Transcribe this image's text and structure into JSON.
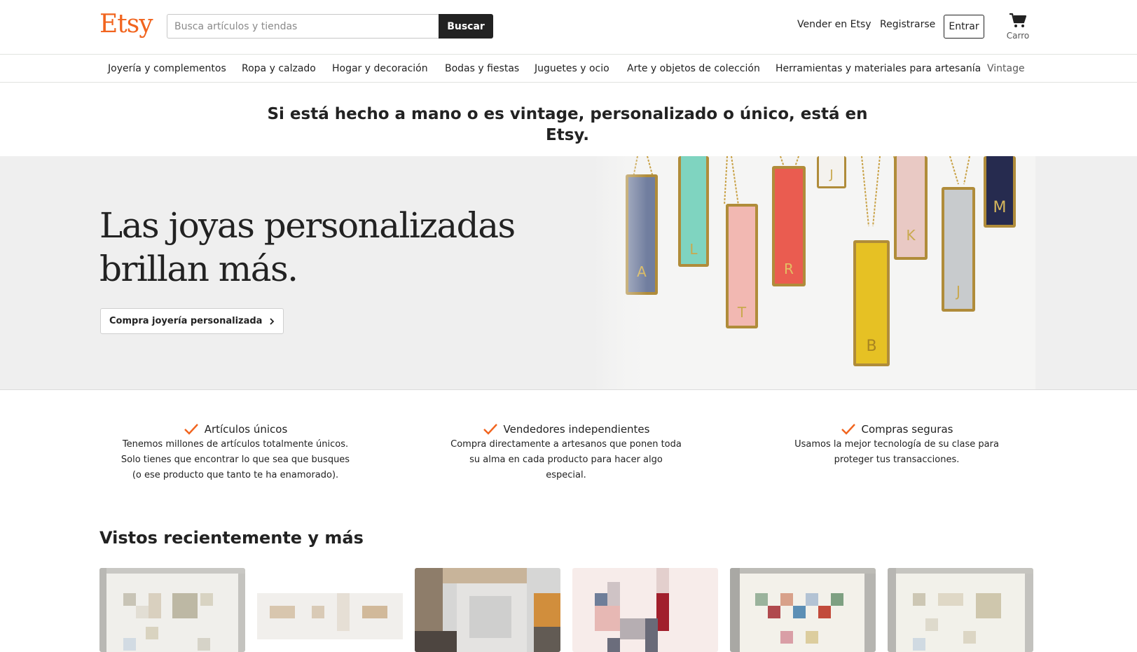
{
  "header": {
    "logo": "Etsy",
    "search_placeholder": "Busca artículos y tiendas",
    "search_button": "Buscar",
    "sell_link": "Vender en Etsy",
    "register_link": "Registrarse",
    "signin_button": "Entrar",
    "cart_label": "Carro",
    "cart_icon": "shopping-cart-icon"
  },
  "categories": [
    "Joyería y complementos",
    "Ropa y calzado",
    "Hogar y decoración",
    "Bodas y fiestas",
    "Juguetes y ocio",
    "Arte y objetos de colección",
    "Herramientas y materiales para artesanía",
    "Vintage"
  ],
  "tagline": {
    "line1": "Si está hecho a mano o es vintage, personalizado o único, está en",
    "line2": "Etsy."
  },
  "hero": {
    "title_line1": "Las joyas personalizadas",
    "title_line2": "brillan más.",
    "cta": "Compra joyería personalizada",
    "pendant_letters": [
      "A",
      "L",
      "T",
      "R",
      "J",
      "B",
      "K",
      "J",
      "M"
    ]
  },
  "value_props": [
    {
      "title": "Artículos únicos",
      "line1": "Tenemos millones de artículos totalmente únicos.",
      "line2": "Solo tienes que encontrar lo que sea que busques",
      "line3": "(o ese producto que tanto te ha enamorado)."
    },
    {
      "title": "Vendedores independientes",
      "line1": "Compra directamente a artesanos que ponen toda",
      "line2": "su alma en cada producto para hacer algo",
      "line3": "especial."
    },
    {
      "title": "Compras seguras",
      "line1": "Usamos la mejor tecnología de su clase para",
      "line2": "proteger tus transacciones.",
      "line3": ""
    }
  ],
  "recent": {
    "title": "Vistos recientemente y más"
  },
  "colors": {
    "brand": "#f1641e",
    "text": "#222222",
    "hero_bg": "#efefef"
  }
}
